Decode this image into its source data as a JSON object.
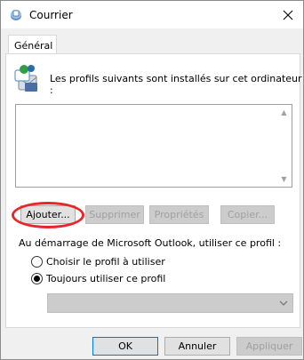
{
  "window": {
    "title": "Courrier"
  },
  "tabs": [
    {
      "label": "Général"
    }
  ],
  "profiles": {
    "label": "Les profils suivants sont installés sur cet ordinateur :",
    "items": []
  },
  "profile_buttons": {
    "add": "Ajouter...",
    "remove": "Supprimer",
    "properties": "Propriétés",
    "copy": "Copier..."
  },
  "startup": {
    "label": "Au démarrage de Microsoft Outlook, utiliser ce profil :",
    "option_prompt": "Choisir le profil à utiliser",
    "option_always": "Toujours utiliser ce profil",
    "selected": "option_always",
    "profile_select_value": ""
  },
  "dialog_buttons": {
    "ok": "OK",
    "cancel": "Annuler",
    "apply": "Appliquer"
  },
  "colors": {
    "annotation_ring": "#e8262a",
    "focus_border": "#0078d7"
  },
  "icons": {
    "app": "mail-profile-icon",
    "profiles": "profiles-icon",
    "close": "close-icon"
  }
}
